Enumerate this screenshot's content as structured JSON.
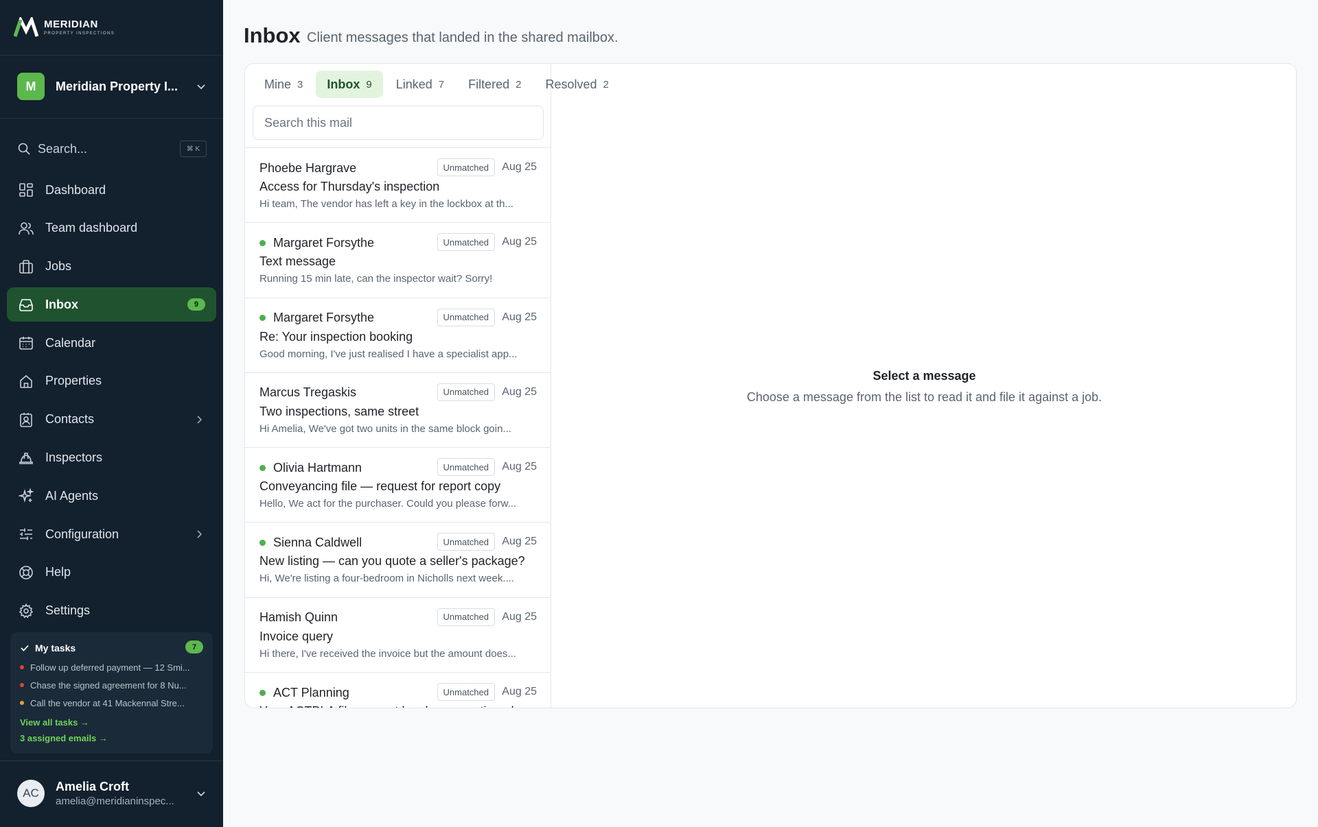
{
  "brand": {
    "name": "MERIDIAN",
    "tagline": "PROPERTY INSPECTIONS",
    "accent": "#5cb84d"
  },
  "org": {
    "initial": "M",
    "name": "Meridian Property I..."
  },
  "search": {
    "label": "Search...",
    "shortcut": "⌘ K"
  },
  "nav": [
    {
      "label": "Dashboard",
      "icon": "dashboard-icon"
    },
    {
      "label": "Team dashboard",
      "icon": "users-icon"
    },
    {
      "label": "Jobs",
      "icon": "briefcase-icon"
    },
    {
      "label": "Inbox",
      "icon": "inbox-icon",
      "badge": "9",
      "active": true
    },
    {
      "label": "Calendar",
      "icon": "calendar-icon"
    },
    {
      "label": "Properties",
      "icon": "home-icon"
    },
    {
      "label": "Contacts",
      "icon": "contact-icon",
      "chevron": true
    },
    {
      "label": "Inspectors",
      "icon": "hard-hat-icon"
    },
    {
      "label": "AI Agents",
      "icon": "sparkles-icon"
    },
    {
      "label": "Configuration",
      "icon": "sliders-icon",
      "chevron": true
    },
    {
      "label": "Help",
      "icon": "lifebuoy-icon"
    },
    {
      "label": "Settings",
      "icon": "gear-icon"
    }
  ],
  "tasks": {
    "title": "My tasks",
    "count": "7",
    "items": [
      {
        "text": "Follow up deferred payment — 12 Smi...",
        "color": "#e0433a"
      },
      {
        "text": "Chase the signed agreement for 8 Nu...",
        "color": "#e0433a"
      },
      {
        "text": "Call the vendor at 41 Mackennal Stre...",
        "color": "#e0a23a"
      }
    ],
    "view_all": "View all tasks →",
    "assigned": "3 assigned emails →"
  },
  "user": {
    "initials": "AC",
    "name": "Amelia Croft",
    "email": "amelia@meridianinspec..."
  },
  "header": {
    "title": "Inbox",
    "subtitle": "Client messages that landed in the shared mailbox."
  },
  "tabs": [
    {
      "label": "Mine",
      "count": "3"
    },
    {
      "label": "Inbox",
      "count": "9",
      "active": true
    },
    {
      "label": "Linked",
      "count": "7"
    },
    {
      "label": "Filtered",
      "count": "2"
    },
    {
      "label": "Resolved",
      "count": "2"
    }
  ],
  "mail_search": {
    "placeholder": "Search this mail"
  },
  "messages": [
    {
      "sender": "Phoebe Hargrave",
      "unread": false,
      "tag": "Unmatched",
      "date": "Aug 25",
      "subject": "Access for Thursday's inspection",
      "preview": "Hi team, The vendor has left a key in the lockbox at th..."
    },
    {
      "sender": "Margaret Forsythe",
      "unread": true,
      "tag": "Unmatched",
      "date": "Aug 25",
      "subject": "Text message",
      "preview": "Running 15 min late, can the inspector wait? Sorry!"
    },
    {
      "sender": "Margaret Forsythe",
      "unread": true,
      "tag": "Unmatched",
      "date": "Aug 25",
      "subject": "Re: Your inspection booking",
      "preview": "Good morning, I've just realised I have a specialist app..."
    },
    {
      "sender": "Marcus Tregaskis",
      "unread": false,
      "tag": "Unmatched",
      "date": "Aug 25",
      "subject": "Two inspections, same street",
      "preview": "Hi Amelia, We've got two units in the same block goin..."
    },
    {
      "sender": "Olivia Hartmann",
      "unread": true,
      "tag": "Unmatched",
      "date": "Aug 25",
      "subject": "Conveyancing file — request for report copy",
      "preview": "Hello, We act for the purchaser. Could you please forw..."
    },
    {
      "sender": "Sienna Caldwell",
      "unread": true,
      "tag": "Unmatched",
      "date": "Aug 25",
      "subject": "New listing — can you quote a seller's package?",
      "preview": "Hi, We're listing a four-bedroom in Nicholls next week...."
    },
    {
      "sender": "Hamish Quinn",
      "unread": false,
      "tag": "Unmatched",
      "date": "Aug 25",
      "subject": "Invoice query",
      "preview": "Hi there, I've received the invoice but the amount does..."
    },
    {
      "sender": "ACT Planning",
      "unread": true,
      "tag": "Unmatched",
      "date": "Aug 25",
      "subject": "Your ACTPLA file request has been reactioned",
      "preview": ""
    }
  ],
  "empty": {
    "title": "Select a message",
    "subtitle": "Choose a message from the list to read it and file it against a job."
  }
}
